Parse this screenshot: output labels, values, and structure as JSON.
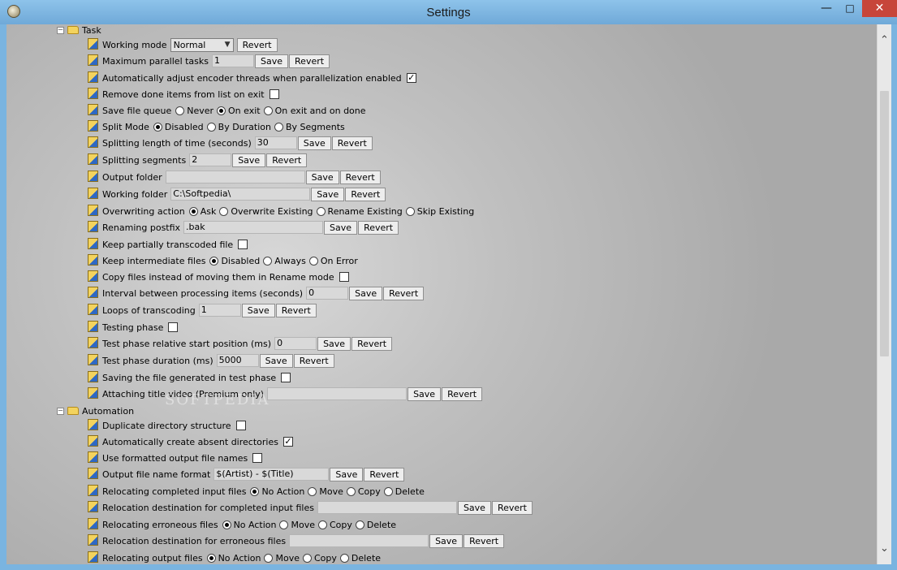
{
  "window": {
    "title": "Settings",
    "minimize_icon": "minimize-icon",
    "maximize_icon": "maximize-icon",
    "close_icon": "close-icon"
  },
  "ui": {
    "save": "Save",
    "revert": "Revert"
  },
  "watermark": "SOFTPEDIA",
  "sections": {
    "task": "Task",
    "automation": "Automation"
  },
  "task": {
    "working_mode": {
      "label": "Working mode",
      "value": "Normal"
    },
    "max_parallel": {
      "label": "Maximum parallel tasks",
      "value": "1"
    },
    "auto_adjust": {
      "label": "Automatically adjust encoder threads when parallelization enabled",
      "checked": true
    },
    "remove_done": {
      "label": "Remove done items from list on exit",
      "checked": false
    },
    "save_queue": {
      "label": "Save file queue",
      "options": [
        "Never",
        "On exit",
        "On exit and on done"
      ],
      "selected": 1
    },
    "split_mode": {
      "label": "Split Mode",
      "options": [
        "Disabled",
        "By Duration",
        "By Segments"
      ],
      "selected": 0
    },
    "split_length": {
      "label": "Splitting length of time (seconds)",
      "value": "30"
    },
    "split_segments": {
      "label": "Splitting segments",
      "value": "2"
    },
    "output_folder": {
      "label": "Output folder",
      "value": ""
    },
    "working_folder": {
      "label": "Working folder",
      "value": "C:\\Softpedia\\"
    },
    "overwrite": {
      "label": "Overwriting action",
      "options": [
        "Ask",
        "Overwrite Existing",
        "Rename Existing",
        "Skip Existing"
      ],
      "selected": 0
    },
    "rename_postfix": {
      "label": "Renaming postfix",
      "value": ".bak"
    },
    "keep_partial": {
      "label": "Keep partially transcoded file",
      "checked": false
    },
    "keep_intermediate": {
      "label": "Keep intermediate files",
      "options": [
        "Disabled",
        "Always",
        "On Error"
      ],
      "selected": 0
    },
    "copy_files": {
      "label": "Copy files instead of moving them in Rename mode",
      "checked": false
    },
    "interval": {
      "label": "Interval between processing items (seconds)",
      "value": "0"
    },
    "loops": {
      "label": "Loops of transcoding",
      "value": "1"
    },
    "testing_phase": {
      "label": "Testing phase",
      "checked": false
    },
    "test_start": {
      "label": "Test phase relative start position (ms)",
      "value": "0"
    },
    "test_duration": {
      "label": "Test phase duration (ms)",
      "value": "5000"
    },
    "save_test_file": {
      "label": "Saving the file generated in test phase",
      "checked": false
    },
    "title_video": {
      "label": "Attaching title video (Premium only)",
      "value": ""
    }
  },
  "automation": {
    "dup_dir": {
      "label": "Duplicate directory structure",
      "checked": false
    },
    "auto_create": {
      "label": "Automatically create absent directories",
      "checked": true
    },
    "use_formatted": {
      "label": "Use formatted output file names",
      "checked": false
    },
    "name_format": {
      "label": "Output file name format",
      "value": "$(Artist) - $(Title)"
    },
    "reloc_completed": {
      "label": "Relocating completed input files",
      "options": [
        "No Action",
        "Move",
        "Copy",
        "Delete"
      ],
      "selected": 0
    },
    "reloc_completed_dest": {
      "label": "Relocation destination for completed input files",
      "value": ""
    },
    "reloc_erroneous": {
      "label": "Relocating erroneous files",
      "options": [
        "No Action",
        "Move",
        "Copy",
        "Delete"
      ],
      "selected": 0
    },
    "reloc_erroneous_dest": {
      "label": "Relocation destination for erroneous files",
      "value": ""
    },
    "reloc_output": {
      "label": "Relocating output files",
      "options": [
        "No Action",
        "Move",
        "Copy",
        "Delete"
      ],
      "selected": 0
    }
  }
}
